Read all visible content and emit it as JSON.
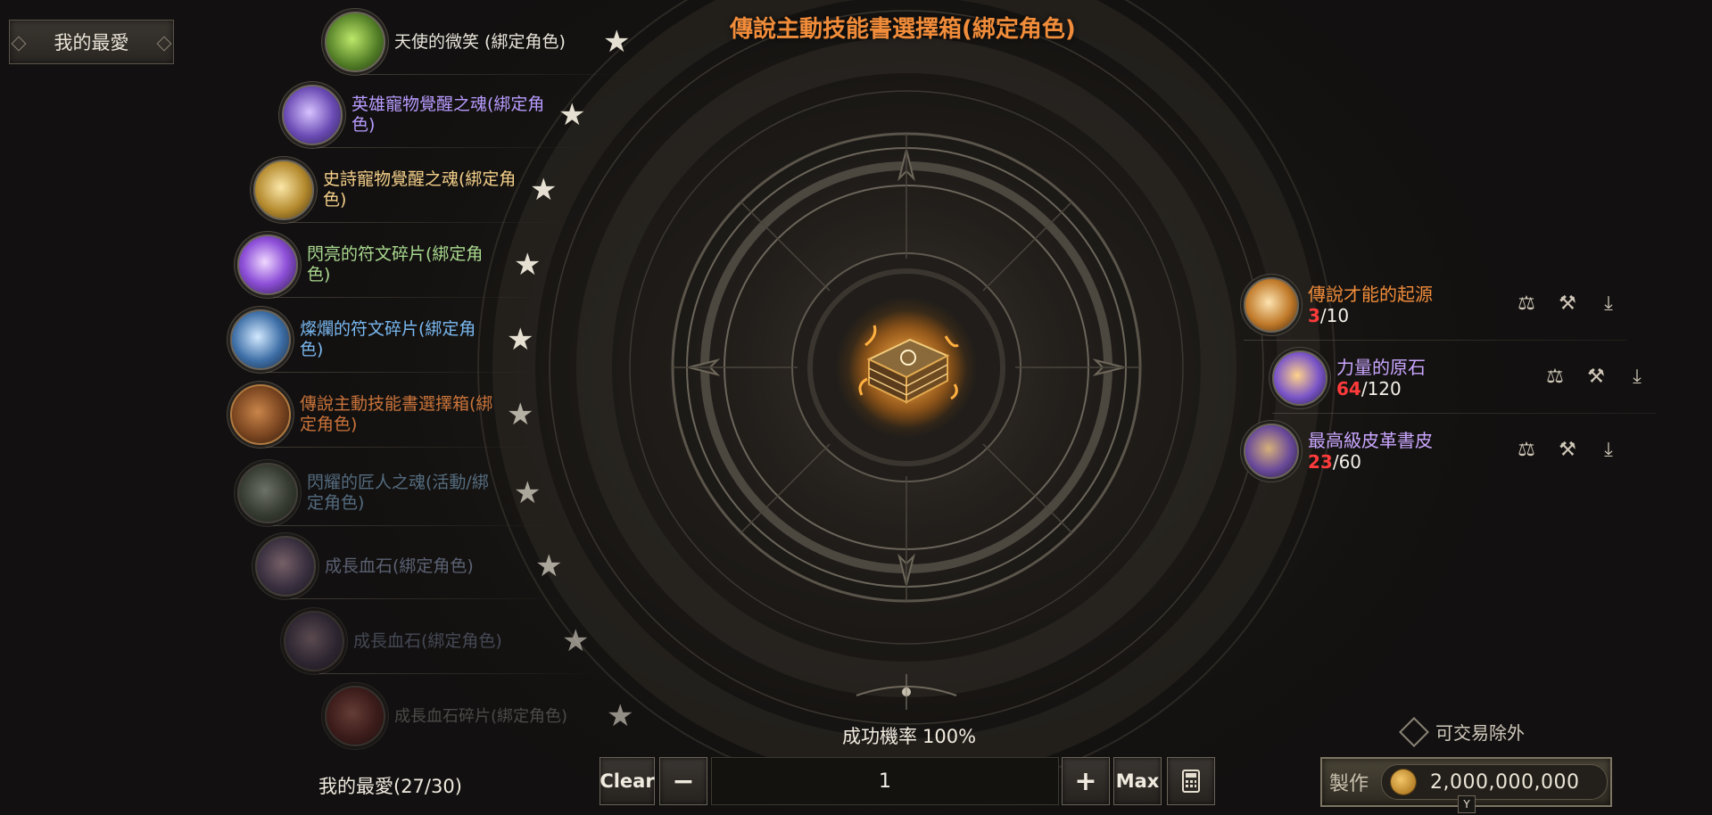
{
  "header": {
    "title": "傳說主動技能書選擇箱(綁定角色)"
  },
  "favorites": {
    "tab_label": "我的最愛",
    "count_label": "我的最愛(27/30)",
    "items": [
      {
        "name": "天使的微笑 (綁定角色)",
        "color": "#e8e4da",
        "icon": "green-gem-icon"
      },
      {
        "name": "英雄寵物覺醒之魂(綁定角色)",
        "color": "#b89cff",
        "icon": "purple-orb-icon"
      },
      {
        "name": "史詩寵物覺醒之魂(綁定角色)",
        "color": "#f5d08a",
        "icon": "golden-orb-icon"
      },
      {
        "name": "閃亮的符文碎片(綁定角色)",
        "color": "#a9d98f",
        "icon": "purple-rune-shard-icon"
      },
      {
        "name": "燦爛的符文碎片(綁定角色)",
        "color": "#79b8f0",
        "icon": "blue-rune-shard-icon"
      },
      {
        "name": "傳說主動技能書選擇箱(綁定角色)",
        "color": "#c9733a",
        "icon": "skill-book-box-icon"
      },
      {
        "name": "閃耀的匠人之魂(活動/綁定角色)",
        "color": "#7fa7c8",
        "icon": "artisan-soul-icon"
      },
      {
        "name": "成長血石(綁定角色)",
        "color": "#8a96b4",
        "icon": "bloodstone-icon"
      },
      {
        "name": "成長血石(綁定角色)",
        "color": "#8a96b4",
        "icon": "bloodstone-icon"
      },
      {
        "name": "成長血石碎片(綁定角色)",
        "color": "#9a9a94",
        "icon": "bloodstone-fragment-icon"
      }
    ]
  },
  "materials": [
    {
      "name": "傳說才能的起源",
      "have": "3",
      "need": "/10",
      "color": "#f08c3a",
      "icon": "talent-origin-icon"
    },
    {
      "name": "力量的原石",
      "have": "64",
      "need": "/120",
      "color": "#c9a6ff",
      "icon": "power-stone-icon"
    },
    {
      "name": "最高級皮革書皮",
      "have": "23",
      "need": "/60",
      "color": "#c9a6ff",
      "icon": "leather-cover-icon"
    }
  ],
  "craft": {
    "rate_label": "成功機率",
    "rate_value": "100%",
    "clear_label": "Clear",
    "minus_label": "−",
    "plus_label": "+",
    "max_label": "Max",
    "quantity": "1",
    "tradable_label": "可交易除外",
    "make_label": "製作",
    "cost": "2,000,000,000",
    "key_hint": "Y"
  }
}
